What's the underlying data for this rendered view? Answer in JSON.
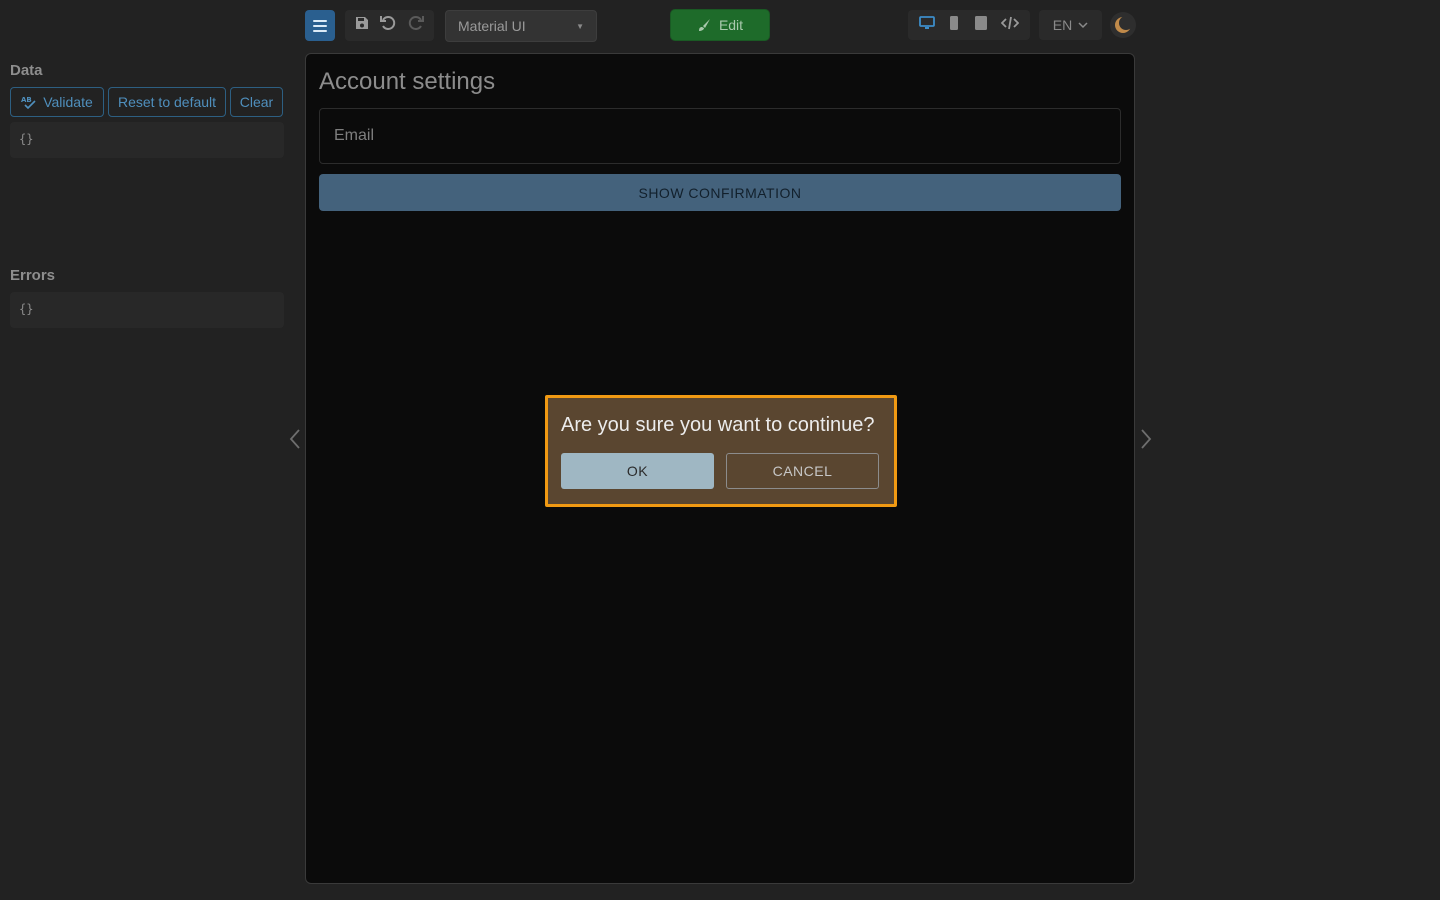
{
  "toolbar": {
    "theme_select": "Material UI",
    "edit_label": "Edit",
    "language": "EN"
  },
  "panel": {
    "data_title": "Data",
    "validate_label": "Validate",
    "reset_label": "Reset to default",
    "clear_label": "Clear",
    "data_value": "{}",
    "errors_title": "Errors",
    "errors_value": "{}"
  },
  "form": {
    "title": "Account settings",
    "email_label": "Email",
    "show_confirmation_label": "SHOW CONFIRMATION"
  },
  "dialog": {
    "message": "Are you sure you want to continue?",
    "ok_label": "OK",
    "cancel_label": "CANCEL"
  },
  "colors": {
    "accent": "#2a5f8f",
    "edit_green": "#1e6b2a",
    "dialog_highlight": "#f19a13"
  }
}
